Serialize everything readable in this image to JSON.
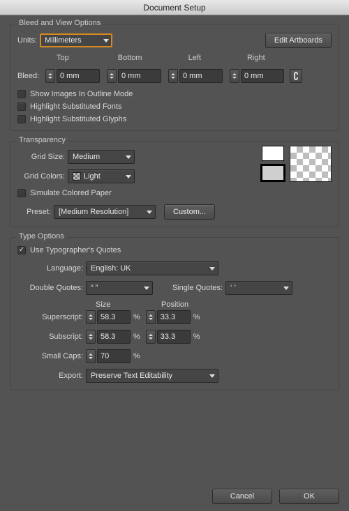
{
  "window": {
    "title": "Document Setup"
  },
  "bleed_view": {
    "legend": "Bleed and View Options",
    "units_label": "Units:",
    "units_value": "Millimeters",
    "edit_artboards": "Edit Artboards",
    "bleed_label": "Bleed:",
    "columns": {
      "top": "Top",
      "bottom": "Bottom",
      "left": "Left",
      "right": "Right"
    },
    "values": {
      "top": "0 mm",
      "bottom": "0 mm",
      "left": "0 mm",
      "right": "0 mm"
    },
    "checkboxes": {
      "outline": "Show Images In Outline Mode",
      "fonts": "Highlight Substituted Fonts",
      "glyphs": "Highlight Substituted Glyphs"
    }
  },
  "transparency": {
    "legend": "Transparency",
    "grid_size_label": "Grid Size:",
    "grid_size_value": "Medium",
    "grid_colors_label": "Grid Colors:",
    "grid_colors_value": "Light",
    "simulate": "Simulate Colored Paper",
    "preset_label": "Preset:",
    "preset_value": "[Medium Resolution]",
    "custom": "Custom...",
    "swatch_white": "#ffffff",
    "swatch_gray": "#cfcfcf"
  },
  "type_options": {
    "legend": "Type Options",
    "typographers": "Use Typographer's Quotes",
    "language_label": "Language:",
    "language_value": "English: UK",
    "double_quotes_label": "Double Quotes:",
    "double_quotes_value": "“ ”",
    "single_quotes_label": "Single Quotes:",
    "single_quotes_value": "‘ ’",
    "size_head": "Size",
    "position_head": "Position",
    "superscript_label": "Superscript:",
    "superscript_size": "58.3",
    "superscript_pos": "33.3",
    "subscript_label": "Subscript:",
    "subscript_size": "58.3",
    "subscript_pos": "33.3",
    "small_caps_label": "Small Caps:",
    "small_caps_value": "70",
    "percent": "%",
    "export_label": "Export:",
    "export_value": "Preserve Text Editability"
  },
  "footer": {
    "cancel": "Cancel",
    "ok": "OK"
  }
}
